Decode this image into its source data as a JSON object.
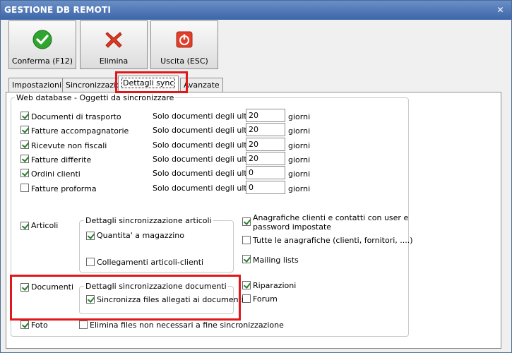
{
  "window": {
    "title": "GESTIONE DB REMOTI",
    "close": "✕"
  },
  "toolbar": {
    "confirm_label": "Conferma (F12)",
    "delete_label": "Elimina",
    "exit_label": "Uscita (ESC)"
  },
  "tabs": [
    "Impostazioni",
    "Sincronizzazione",
    "Dettagli sync",
    "Avanzate"
  ],
  "section_title": "Web database - Oggetti da sincronizzare",
  "doc_rows": [
    {
      "label": "Documenti di trasporto",
      "checked": true,
      "prefix": "Solo documenti degli ultimi",
      "value": "20",
      "suffix": "giorni"
    },
    {
      "label": "Fatture accompagnatorie",
      "checked": true,
      "prefix": "Solo documenti degli ultimi",
      "value": "20",
      "suffix": "giorni"
    },
    {
      "label": "Ricevute non fiscali",
      "checked": true,
      "prefix": "Solo documenti degli ultimi",
      "value": "20",
      "suffix": "giorni"
    },
    {
      "label": "Fatture differite",
      "checked": true,
      "prefix": "Solo documenti degli ultimi",
      "value": "20",
      "suffix": "giorni"
    },
    {
      "label": "Ordini clienti",
      "checked": true,
      "prefix": "Solo documenti degli ultimi",
      "value": "0",
      "suffix": "giorni"
    },
    {
      "label": "Fatture proforma",
      "checked": false,
      "prefix": "Solo documenti degli ultimi",
      "value": "0",
      "suffix": "giorni"
    }
  ],
  "articoli": {
    "label": "Articoli",
    "group_title": "Dettagli sincronizzazione articoli",
    "quantita": "Quantita' a magazzino",
    "collegamenti": "Collegamenti articoli-clienti"
  },
  "right_options": {
    "anagrafiche_line1": "Anagrafiche clienti e contatti con user e",
    "anagrafiche_line2": "password impostate",
    "tutte": "Tutte le anagrafiche (clienti, fornitori, ....)",
    "mailing": "Mailing lists",
    "riparazioni": "Riparazioni",
    "forum": "Forum"
  },
  "documenti": {
    "label": "Documenti",
    "group_title": "Dettagli sincronizzazione documenti",
    "sync_files": "Sincronizza files allegati ai documenti"
  },
  "foto": {
    "label": "Foto",
    "elimina": "Elimina files non necessari a fine sincronizzazione"
  },
  "colors": {
    "highlight": "#e0181b",
    "check": "#2a7d2a",
    "titlebar": "#3d66a8"
  }
}
